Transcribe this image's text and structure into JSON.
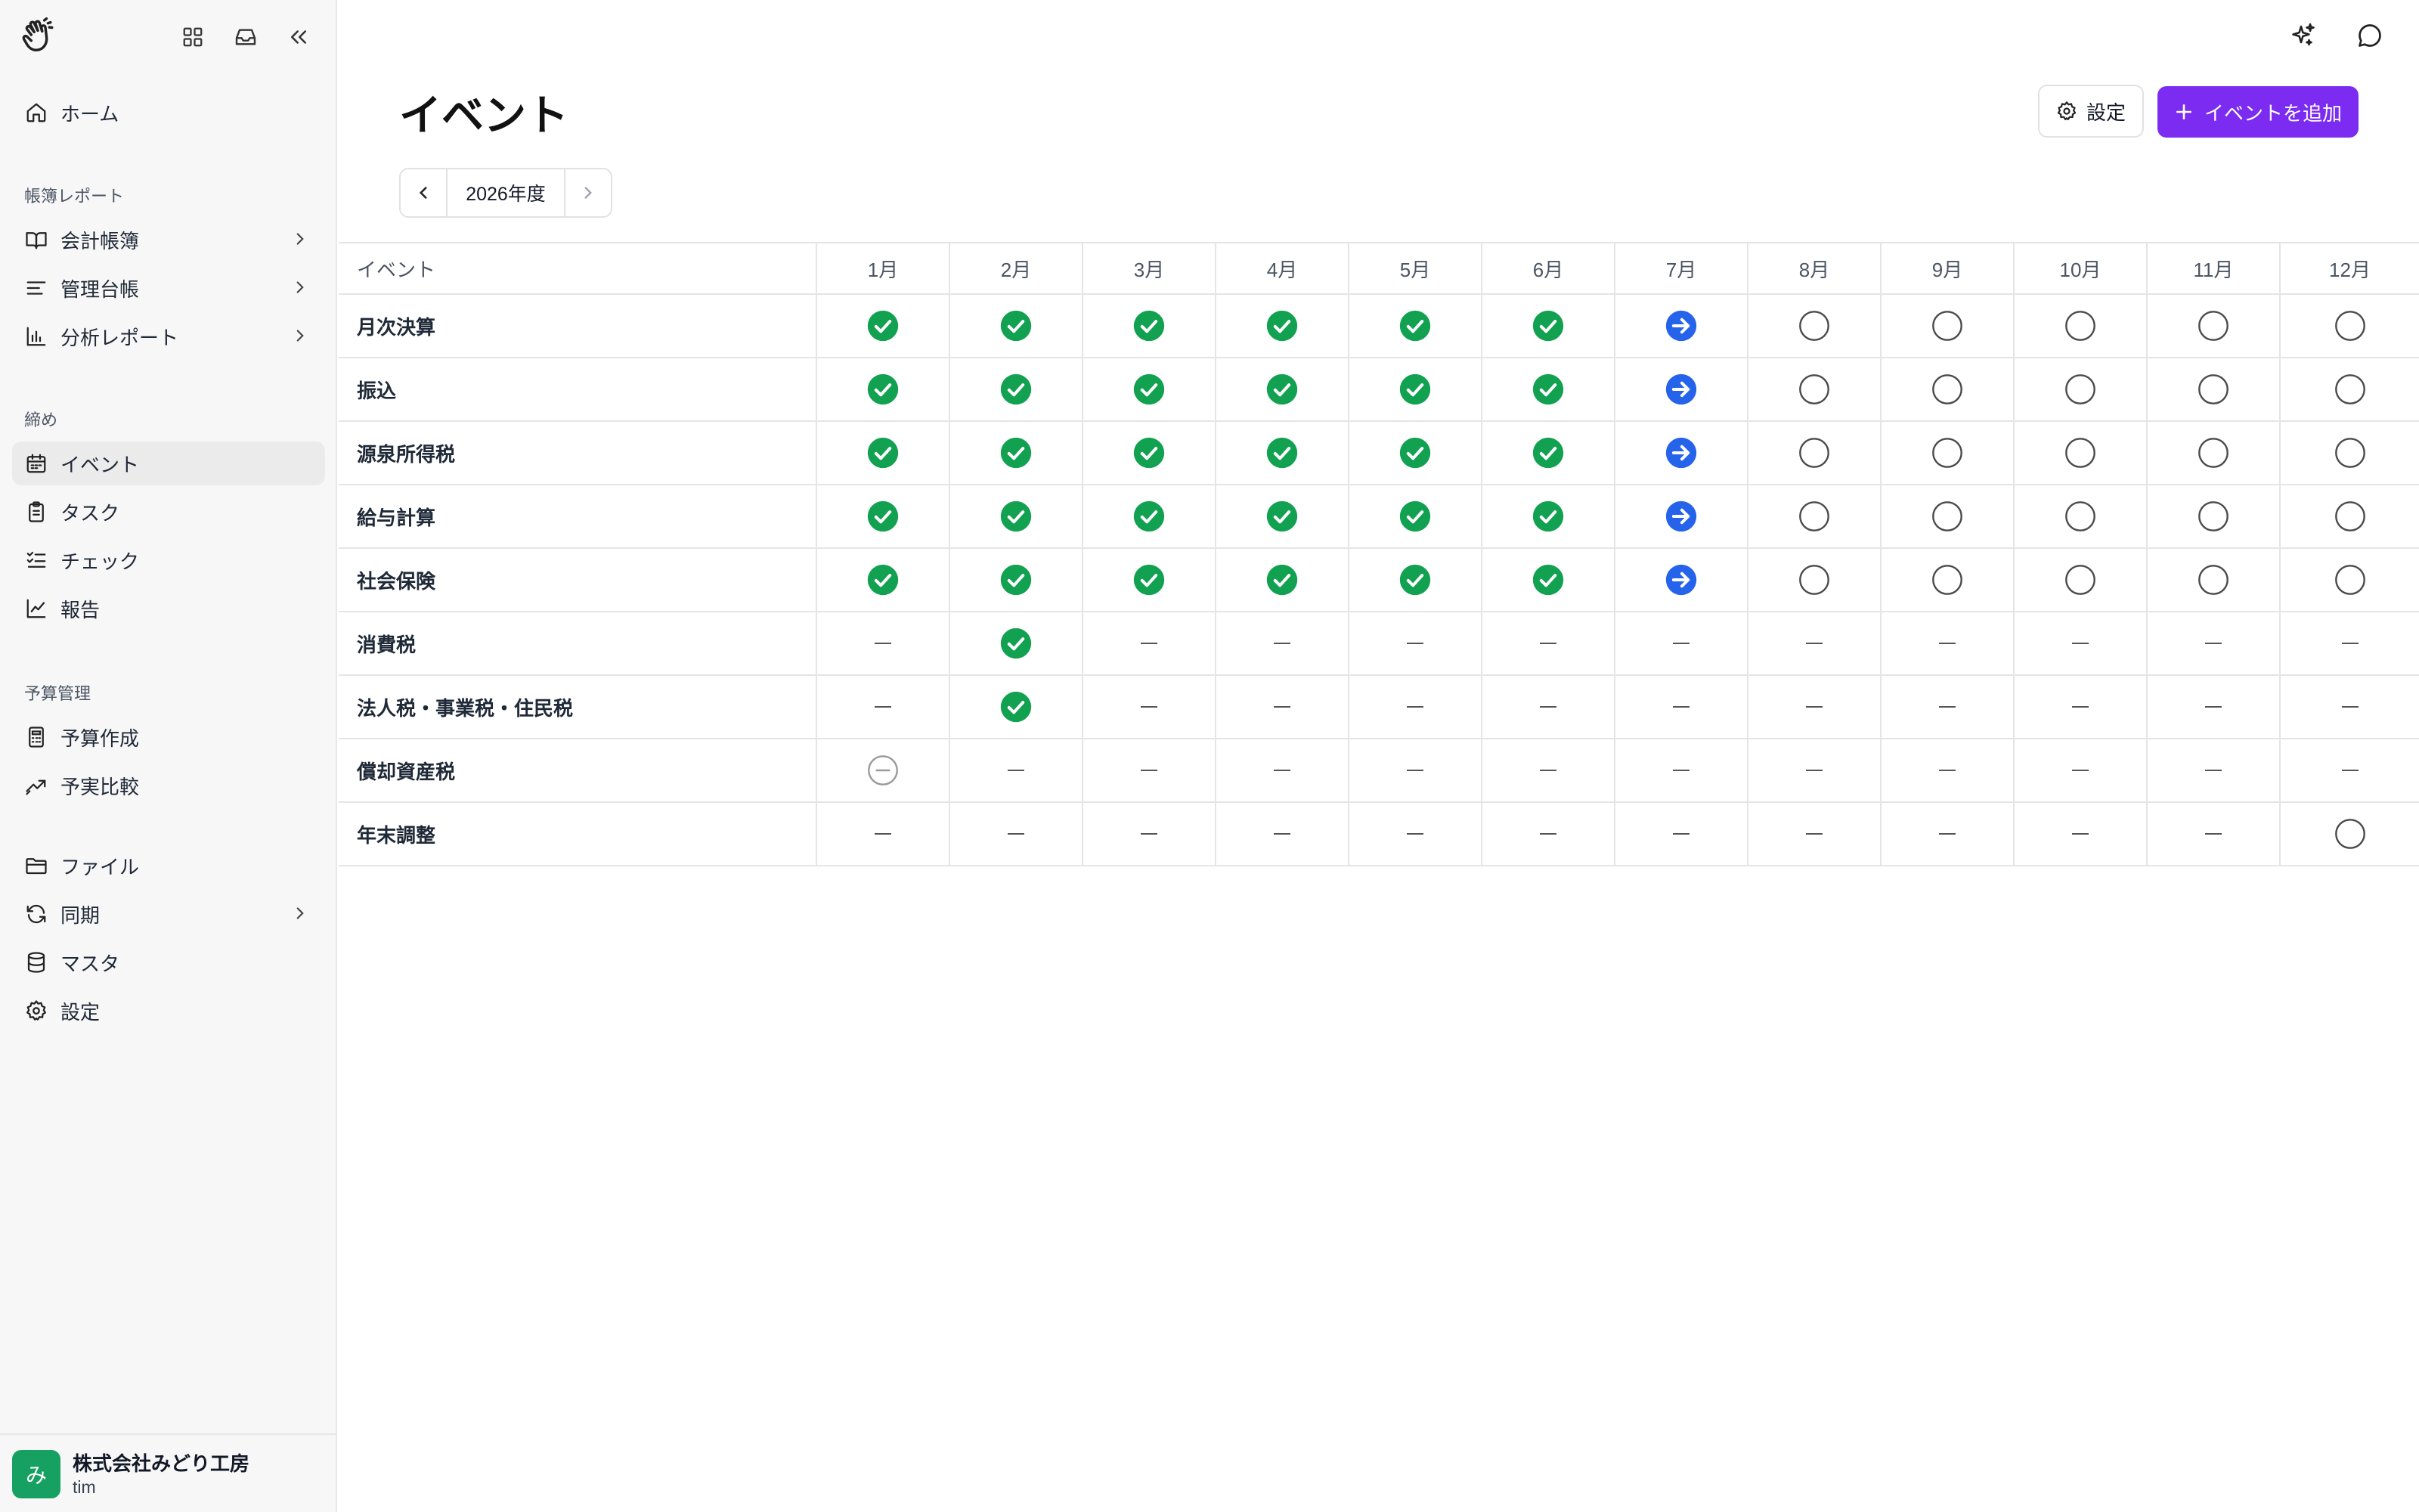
{
  "sidebar": {
    "nav_groups": {
      "home": {
        "label": "ホーム",
        "icon": "home-icon"
      },
      "ledger_section": "帳簿レポート",
      "ledger_items": [
        {
          "label": "会計帳簿",
          "icon": "book-open-icon",
          "has_submenu": true
        },
        {
          "label": "管理台帳",
          "icon": "list-icon",
          "has_submenu": true
        },
        {
          "label": "分析レポート",
          "icon": "bar-chart-icon",
          "has_submenu": true
        }
      ],
      "closing_section": "締め",
      "closing_items": [
        {
          "label": "イベント",
          "icon": "calendar-icon",
          "active": true
        },
        {
          "label": "タスク",
          "icon": "clipboard-icon"
        },
        {
          "label": "チェック",
          "icon": "checklist-icon"
        },
        {
          "label": "報告",
          "icon": "line-chart-icon"
        }
      ],
      "budget_section": "予算管理",
      "budget_items": [
        {
          "label": "予算作成",
          "icon": "calculator-icon"
        },
        {
          "label": "予実比較",
          "icon": "trend-icon"
        }
      ],
      "misc_items": [
        {
          "label": "ファイル",
          "icon": "folder-icon"
        },
        {
          "label": "同期",
          "icon": "sync-icon",
          "has_submenu": true
        },
        {
          "label": "マスタ",
          "icon": "database-icon"
        },
        {
          "label": "設定",
          "icon": "gear-icon"
        }
      ]
    },
    "org": {
      "avatar_text": "み",
      "name": "株式会社みどり工房",
      "user": "tim",
      "avatar_color": "#16a061"
    }
  },
  "header": {
    "title": "イベント",
    "settings_label": "設定",
    "add_label": "イベントを追加",
    "accent_color": "#7c2bf0"
  },
  "year_nav": {
    "label": "2026年度"
  },
  "table": {
    "event_header": "イベント",
    "months": [
      "1月",
      "2月",
      "3月",
      "4月",
      "5月",
      "6月",
      "7月",
      "8月",
      "9月",
      "10月",
      "11月",
      "12月"
    ],
    "status_legend": {
      "done": "#12a150",
      "in_progress": "#2563eb",
      "pending": "outline-circle",
      "skipped": "minus-circle",
      "none": "dash"
    },
    "rows": [
      {
        "name": "月次決算",
        "statuses": [
          "done",
          "done",
          "done",
          "done",
          "done",
          "done",
          "in_progress",
          "pending",
          "pending",
          "pending",
          "pending",
          "pending"
        ]
      },
      {
        "name": "振込",
        "statuses": [
          "done",
          "done",
          "done",
          "done",
          "done",
          "done",
          "in_progress",
          "pending",
          "pending",
          "pending",
          "pending",
          "pending"
        ]
      },
      {
        "name": "源泉所得税",
        "statuses": [
          "done",
          "done",
          "done",
          "done",
          "done",
          "done",
          "in_progress",
          "pending",
          "pending",
          "pending",
          "pending",
          "pending"
        ]
      },
      {
        "name": "給与計算",
        "statuses": [
          "done",
          "done",
          "done",
          "done",
          "done",
          "done",
          "in_progress",
          "pending",
          "pending",
          "pending",
          "pending",
          "pending"
        ]
      },
      {
        "name": "社会保険",
        "statuses": [
          "done",
          "done",
          "done",
          "done",
          "done",
          "done",
          "in_progress",
          "pending",
          "pending",
          "pending",
          "pending",
          "pending"
        ]
      },
      {
        "name": "消費税",
        "statuses": [
          "none",
          "done",
          "none",
          "none",
          "none",
          "none",
          "none",
          "none",
          "none",
          "none",
          "none",
          "none"
        ]
      },
      {
        "name": "法人税・事業税・住民税",
        "statuses": [
          "none",
          "done",
          "none",
          "none",
          "none",
          "none",
          "none",
          "none",
          "none",
          "none",
          "none",
          "none"
        ]
      },
      {
        "name": "償却資産税",
        "statuses": [
          "skipped",
          "none",
          "none",
          "none",
          "none",
          "none",
          "none",
          "none",
          "none",
          "none",
          "none",
          "none"
        ]
      },
      {
        "name": "年末調整",
        "statuses": [
          "none",
          "none",
          "none",
          "none",
          "none",
          "none",
          "none",
          "none",
          "none",
          "none",
          "none",
          "pending"
        ]
      }
    ]
  }
}
